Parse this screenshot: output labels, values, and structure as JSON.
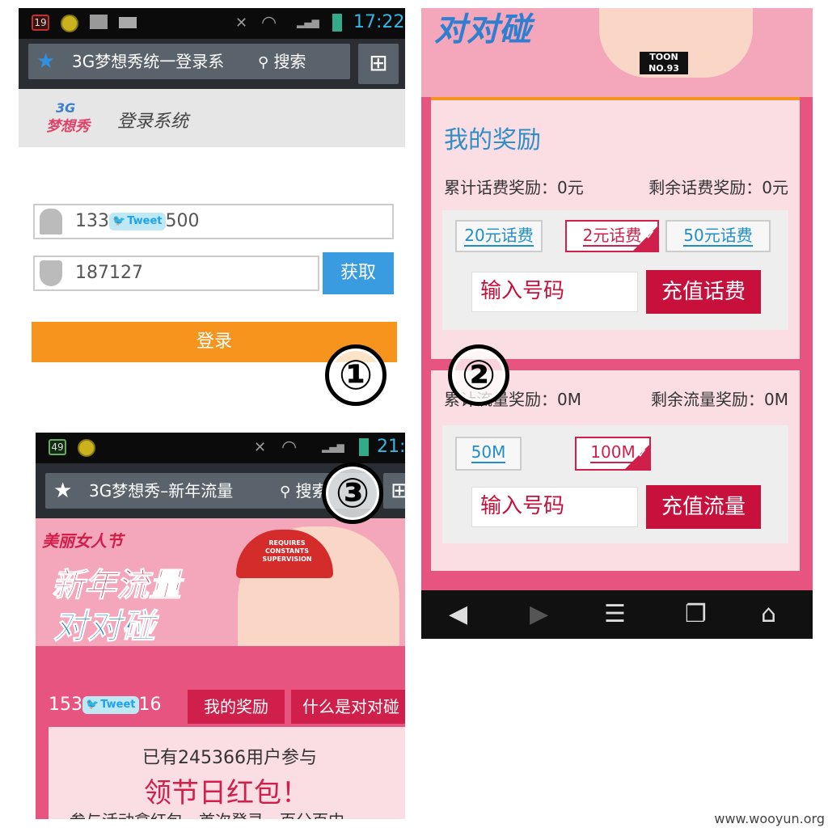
{
  "panel1": {
    "status": {
      "badge": "19",
      "time": "17:22"
    },
    "addressbar": {
      "title": "3G梦想秀统一登录系",
      "search": "搜索"
    },
    "header": {
      "logo_top": "3G",
      "logo_bottom": "梦想秀",
      "title": "登录系统"
    },
    "phone": {
      "prefix": "133",
      "suffix": "500"
    },
    "code": "187127",
    "get_button": "获取",
    "login_button": "登录"
  },
  "panel2": {
    "section_title": "我的奖励",
    "phone_total": "累计话费奖励：0元",
    "phone_remaining": "剩余话费奖励：0元",
    "phone_options": [
      "20元话费",
      "2元话费",
      "50元话费"
    ],
    "input_placeholder": "输入号码",
    "phone_recharge": "充值话费",
    "data_total": "累计流量奖励：0M",
    "data_remaining": "剩余流量奖励：0M",
    "data_options": [
      "50M",
      "100M"
    ],
    "data_recharge": "充值流量",
    "banner_bottom": "对对碰",
    "badge_text": "TOON NO.93"
  },
  "panel3": {
    "status": {
      "badge": "49",
      "time": "21:"
    },
    "addressbar": {
      "title": "3G梦想秀–新年流量",
      "search": "搜索"
    },
    "banner": {
      "line1": "美丽女人节",
      "line2": "新年流量",
      "line3": "对对碰",
      "cap_text": "REQUIRES CONSTANTS SUPERVISION"
    },
    "phone": {
      "prefix": "153",
      "suffix": "16"
    },
    "tabs": [
      "我的奖励",
      "什么是对对碰"
    ],
    "participants": "已有245366用户参与",
    "headline": "领节日红包！",
    "subline": "参与活动拿红包，首次登录，百分百中"
  },
  "markers": [
    "①",
    "②",
    "③"
  ],
  "tweet_label": "Tweet",
  "watermark": "www.wooyun.org",
  "colors": {
    "orange": "#f7941d",
    "blue": "#3a9ce0",
    "pink": "#e75480",
    "red": "#c8103d",
    "status_blue": "#33b5e5"
  }
}
